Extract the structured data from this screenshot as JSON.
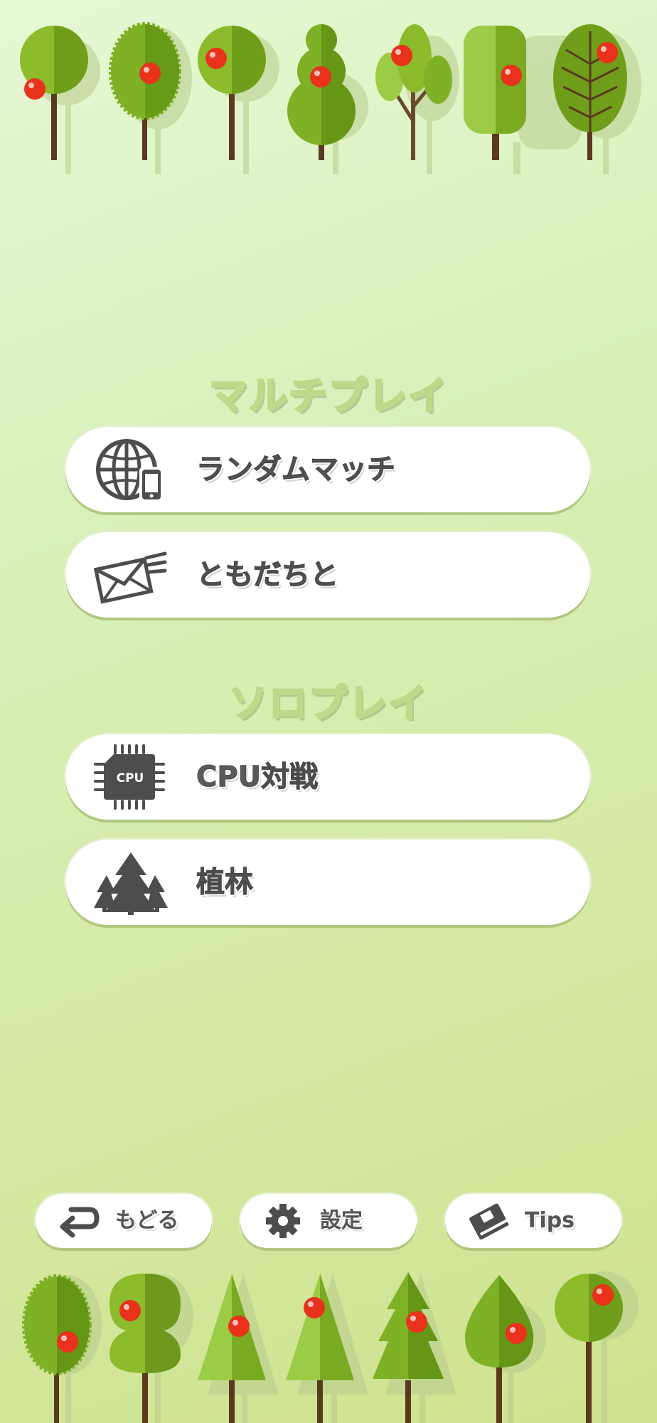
{
  "sections": {
    "multiplayer_title": "マルチプレイ",
    "solo_title": "ソロプレイ"
  },
  "buttons": {
    "random_match": {
      "label": "ランダムマッチ",
      "icon": "globe-phone-icon"
    },
    "with_friends": {
      "label": "ともだちと",
      "icon": "mail-icon"
    },
    "cpu_battle": {
      "label": "CPU対戦",
      "icon": "cpu-chip-icon",
      "icon_text": "CPU"
    },
    "planting": {
      "label": "植林",
      "icon": "forest-icon"
    }
  },
  "footer": {
    "back": {
      "label": "もどる",
      "icon": "return-arrow-icon"
    },
    "settings": {
      "label": "設定",
      "icon": "gear-icon"
    },
    "tips": {
      "label": "Tips",
      "icon": "book-icon"
    }
  },
  "colors": {
    "background_top": "#e6f8d4",
    "background_bottom": "#cfe28f",
    "leaf_light": "#9cc93a",
    "leaf_dark": "#6d9a1c",
    "trunk": "#5a3a1e",
    "apple": "#e8321c",
    "icon_gray": "#4d4d4d"
  }
}
